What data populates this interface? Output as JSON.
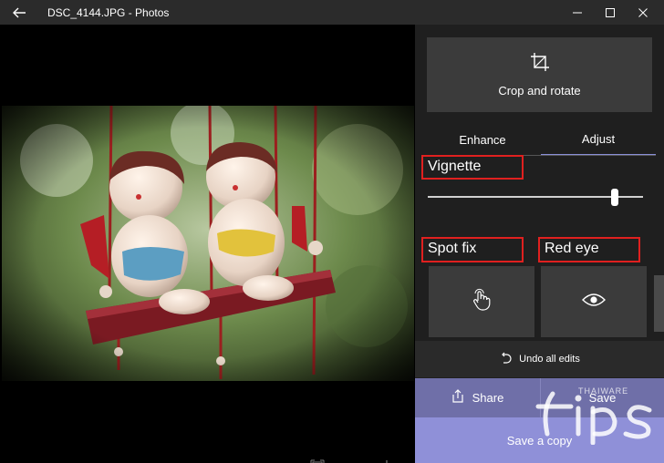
{
  "window": {
    "title": "DSC_4144.JPG - Photos",
    "controls": [
      "minimize",
      "maximize",
      "close"
    ]
  },
  "viewer": {
    "photo_description_icon": "photo-image",
    "tools": [
      "fit-to-window-icon",
      "zoom-out-icon",
      "zoom-in-icon"
    ]
  },
  "panel": {
    "crop": {
      "label": "Crop and rotate",
      "icon": "crop-icon"
    },
    "tabs": [
      {
        "label": "Enhance",
        "active": false
      },
      {
        "label": "Adjust",
        "active": true
      }
    ],
    "vignette": {
      "label": "Vignette",
      "value": 0.88
    },
    "spot_fix": {
      "label": "Spot fix",
      "icon": "touch-hand-icon"
    },
    "red_eye": {
      "label": "Red eye",
      "icon": "eye-icon"
    },
    "undo": {
      "label": "Undo all edits",
      "icon": "undo-icon"
    },
    "share": {
      "label": "Share",
      "icon": "share-icon"
    },
    "save": {
      "label": "Save"
    },
    "save_copy": {
      "label": "Save a copy"
    }
  },
  "watermark": {
    "brand": "THAIWARE",
    "text": "tips"
  },
  "colors": {
    "accent": "#8f90d8",
    "accent_dark": "#6f6fa8",
    "highlight_border": "#e0201f",
    "panel_bg": "#1f1f1f",
    "tile_bg": "#3b3b3b"
  }
}
